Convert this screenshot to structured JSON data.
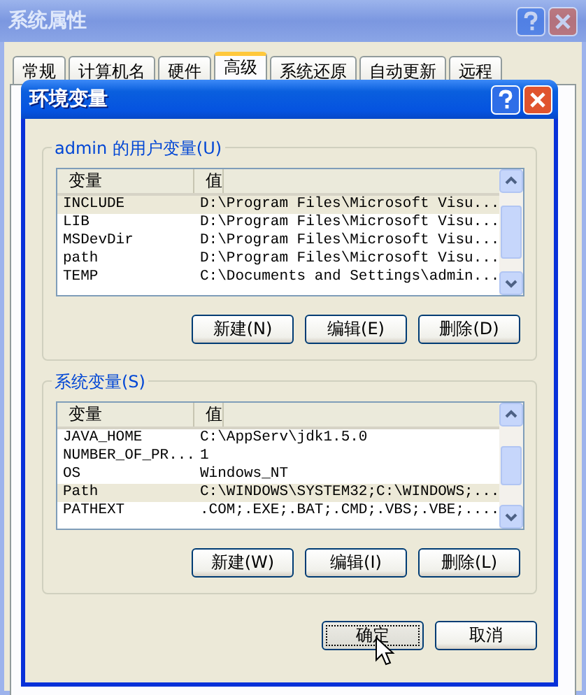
{
  "window": {
    "title": "系统属性",
    "active": false
  },
  "tabs": [
    {
      "label": "常规",
      "selected": false
    },
    {
      "label": "计算机名",
      "selected": false
    },
    {
      "label": "硬件",
      "selected": false
    },
    {
      "label": "高级",
      "selected": true
    },
    {
      "label": "系统还原",
      "selected": false
    },
    {
      "label": "自动更新",
      "selected": false
    },
    {
      "label": "远程",
      "selected": false
    }
  ],
  "dialog": {
    "title": "环境变量",
    "groups": [
      {
        "label": "admin 的用户变量(U)",
        "columns": [
          "变量",
          "值"
        ],
        "rows": [
          {
            "name": "INCLUDE",
            "value": "D:\\Program Files\\Microsoft Visu...",
            "selected": true
          },
          {
            "name": "LIB",
            "value": "D:\\Program Files\\Microsoft Visu...",
            "selected": false
          },
          {
            "name": "MSDevDir",
            "value": "D:\\Program Files\\Microsoft Visu...",
            "selected": false
          },
          {
            "name": "path",
            "value": "D:\\Program Files\\Microsoft Visu...",
            "selected": false
          },
          {
            "name": "TEMP",
            "value": "C:\\Documents and Settings\\admin...",
            "selected": false
          }
        ],
        "buttons": [
          "新建(N)",
          "编辑(E)",
          "删除(D)"
        ]
      },
      {
        "label": "系统变量(S)",
        "columns": [
          "变量",
          "值"
        ],
        "rows": [
          {
            "name": "JAVA_HOME",
            "value": "C:\\AppServ\\jdk1.5.0",
            "selected": false
          },
          {
            "name": "NUMBER_OF_PR...",
            "value": "1",
            "selected": false
          },
          {
            "name": "OS",
            "value": "Windows_NT",
            "selected": false
          },
          {
            "name": "Path",
            "value": "C:\\WINDOWS\\SYSTEM32;C:\\WINDOWS;...",
            "selected": true
          },
          {
            "name": "PATHEXT",
            "value": ".COM;.EXE;.BAT;.CMD;.VBS;.VBE;....",
            "selected": false
          }
        ],
        "buttons": [
          "新建(W)",
          "编辑(I)",
          "删除(L)"
        ]
      }
    ],
    "buttons": [
      {
        "label": "确定",
        "focused": true
      },
      {
        "label": "取消",
        "focused": false
      }
    ]
  }
}
